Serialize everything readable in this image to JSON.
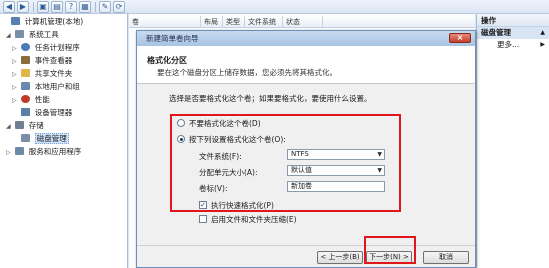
{
  "tree": {
    "items": [
      {
        "label": "计算机管理(本地)",
        "icon": "computer-management-icon",
        "color": "#5a7fb0"
      },
      {
        "label": "系统工具",
        "icon": "tools-icon",
        "color": "#7a8fa8"
      },
      {
        "label": "任务计划程序",
        "icon": "clock-icon",
        "color": "#4b7bb8"
      },
      {
        "label": "事件查看器",
        "icon": "event-viewer-icon",
        "color": "#8a6d3b"
      },
      {
        "label": "共享文件夹",
        "icon": "shared-folder-icon",
        "color": "#e0b84a"
      },
      {
        "label": "本地用户和组",
        "icon": "users-icon",
        "color": "#6b88b0"
      },
      {
        "label": "性能",
        "icon": "performance-icon",
        "color": "#c0392b"
      },
      {
        "label": "设备管理器",
        "icon": "device-manager-icon",
        "color": "#5b7fa6"
      },
      {
        "label": "存储",
        "icon": "storage-icon",
        "color": "#6f7f94"
      },
      {
        "label": "磁盘管理",
        "icon": "disk-management-icon",
        "color": "#7b8ea8"
      },
      {
        "label": "服务和应用程序",
        "icon": "services-icon",
        "color": "#6f8aa6"
      }
    ]
  },
  "columns": [
    "卷",
    "布局",
    "类型",
    "文件系统",
    "状态"
  ],
  "actions": {
    "header": "操作",
    "section": "磁盘管理",
    "more": "更多..."
  },
  "dialog": {
    "title": "新建简单卷向导",
    "heading": "格式化分区",
    "subheading": "要在这个磁盘分区上储存数据，您必须先将其格式化。",
    "prompt": "选择是否要格式化这个卷；如果要格式化，要使用什么设置。",
    "option_no_format": "不要格式化这个卷(D)",
    "option_format": "按下列设置格式化这个卷(O):",
    "fs_label": "文件系统(F):",
    "fs_value": "NTFS",
    "alloc_label": "分配单元大小(A):",
    "alloc_value": "默认值",
    "volume_label": "卷标(V):",
    "volume_value": "新加卷",
    "quick_format": "执行快速格式化(P)",
    "compression": "启用文件和文件夹压缩(E)",
    "back_button": "< 上一步(B)",
    "next_button": "下一步(N) >",
    "cancel_button": "取消"
  },
  "colors": {
    "highlight_red": "#e0161d",
    "titlebar": "#a9c3e3",
    "selection": "#cfe3fb"
  }
}
